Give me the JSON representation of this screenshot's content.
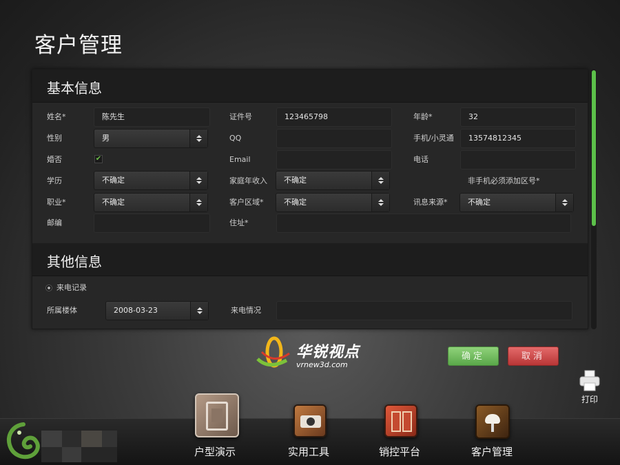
{
  "page": {
    "title": "客户管理"
  },
  "basic_info": {
    "title": "基本信息",
    "name": {
      "label": "姓名*",
      "value": "陈先生"
    },
    "id_number": {
      "label": "证件号",
      "value": "123465798"
    },
    "age": {
      "label": "年龄*",
      "value": "32"
    },
    "gender": {
      "label": "性别",
      "value": "男"
    },
    "qq": {
      "label": "QQ",
      "value": ""
    },
    "mobile": {
      "label": "手机/小灵通",
      "value": "13574812345"
    },
    "married": {
      "label": "婚否",
      "checked": true,
      "check_glyph": "✔"
    },
    "email": {
      "label": "Email",
      "value": ""
    },
    "phone": {
      "label": "电话",
      "value": ""
    },
    "education": {
      "label": "学历",
      "value": "不确定"
    },
    "family_income": {
      "label": "家庭年收入",
      "value": "不确定"
    },
    "phone_note": "非手机必须添加区号*",
    "occupation": {
      "label": "职业*",
      "value": "不确定"
    },
    "customer_area": {
      "label": "客户区域*",
      "value": "不确定"
    },
    "info_source": {
      "label": "讯息来源*",
      "value": "不确定"
    },
    "postcode": {
      "label": "邮编",
      "value": ""
    },
    "address": {
      "label": "住址*",
      "value": ""
    }
  },
  "other_info": {
    "title": "其他信息",
    "call_record": {
      "label": "来电记录"
    },
    "building": {
      "label": "所属楼体",
      "value": "2008-03-23"
    },
    "call_status": {
      "label": "来电情况",
      "value": ""
    }
  },
  "actions": {
    "confirm": "确定",
    "cancel": "取消",
    "print": "打印"
  },
  "brand": {
    "name": "华锐视点",
    "url": "vrnew3d.com"
  },
  "nav": [
    {
      "label": "户型演示",
      "icon": "door-icon"
    },
    {
      "label": "实用工具",
      "icon": "camera-icon"
    },
    {
      "label": "销控平台",
      "icon": "cabinet-icon"
    },
    {
      "label": "客户管理",
      "icon": "chair-icon"
    }
  ],
  "colors": {
    "accent_green": "#5cc04a",
    "cancel_red": "#c43c3c",
    "panel_bg": "#272727"
  }
}
